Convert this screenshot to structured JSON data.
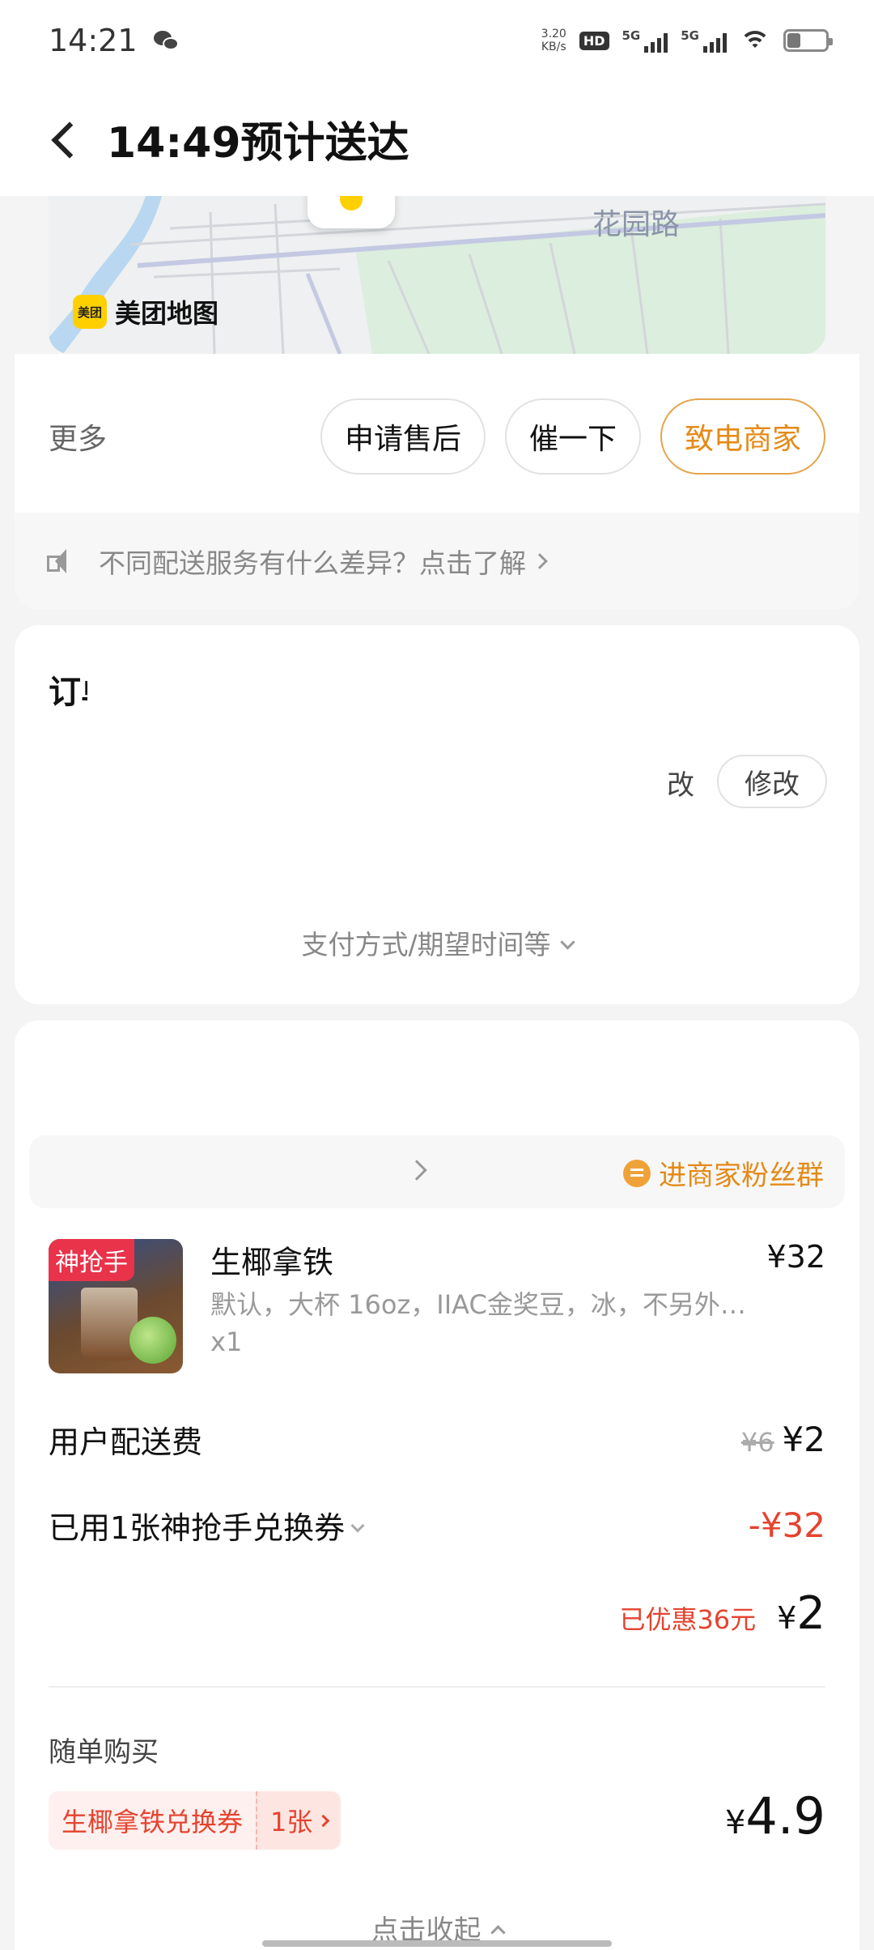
{
  "status_bar": {
    "time": "14:21",
    "net_speed": "3.20",
    "net_speed_unit": "KB/s",
    "hd": "HD",
    "sim1": "5G",
    "sim2": "5G"
  },
  "nav": {
    "title": "14:49预计送达"
  },
  "map": {
    "road_label": "花园路",
    "logo_badge": "美团",
    "logo_text": "美团地图"
  },
  "actions": {
    "more_label": "更多",
    "buttons": [
      "申请售后",
      "催一下",
      "致电商家"
    ]
  },
  "info_strip": {
    "text": "不同配送服务有什么差异？点击了解"
  },
  "order_info": {
    "title": "订单",
    "edit_ghost": "改",
    "edit_label": "修改",
    "pay_expand": "支付方式/期望时间等"
  },
  "shop": {
    "fan_group": "进商家粉丝群"
  },
  "product": {
    "badge": "神抢手",
    "name": "生椰拿铁",
    "price": "¥32",
    "desc": "默认，大杯 16oz，IIAC金奖豆，冰，不另外…",
    "qty": "x1"
  },
  "fees": {
    "delivery_label": "用户配送费",
    "delivery_original": "¥6",
    "delivery_price": "¥2",
    "coupon_label": "已用1张神抢手兑换券",
    "coupon_value": "-¥32"
  },
  "total": {
    "discount": "已优惠36元",
    "symbol": "¥",
    "amount": "2"
  },
  "addon": {
    "title": "随单购买",
    "coupon_name": "生椰拿铁兑换券",
    "coupon_count": "1张",
    "price_symbol": "¥",
    "price": "4.9"
  },
  "collapse_label": "点击收起",
  "colors": {
    "accent_orange": "#e48a17",
    "price_red": "#e5432f",
    "brand_yellow": "#ffd000"
  }
}
